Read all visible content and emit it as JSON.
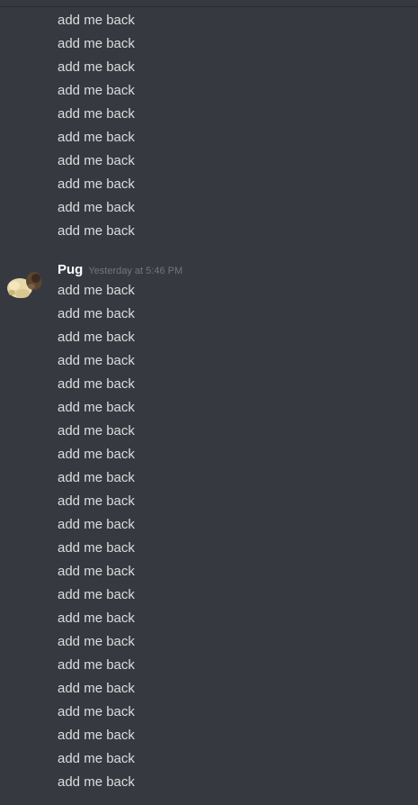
{
  "chat": {
    "first_group": {
      "messages": [
        "add me back",
        "add me back",
        "add me back",
        "add me back",
        "add me back",
        "add me back",
        "add me back",
        "add me back",
        "add me back",
        "add me back"
      ]
    },
    "second_group": {
      "author": "Pug",
      "timestamp": "Yesterday at 5:46 PM",
      "messages": [
        "add me back",
        "add me back",
        "add me back",
        "add me back",
        "add me back",
        "add me back",
        "add me back",
        "add me back",
        "add me back",
        "add me back",
        "add me back",
        "add me back",
        "add me back",
        "add me back",
        "add me back",
        "add me back",
        "add me back",
        "add me back",
        "add me back",
        "add me back",
        "add me back",
        "add me back"
      ]
    }
  },
  "colors": {
    "background": "#36393f",
    "message_text": "#dcddde",
    "author_text": "#ffffff",
    "timestamp_text": "#72767d"
  },
  "icons": {
    "avatar": "pug-avatar"
  }
}
